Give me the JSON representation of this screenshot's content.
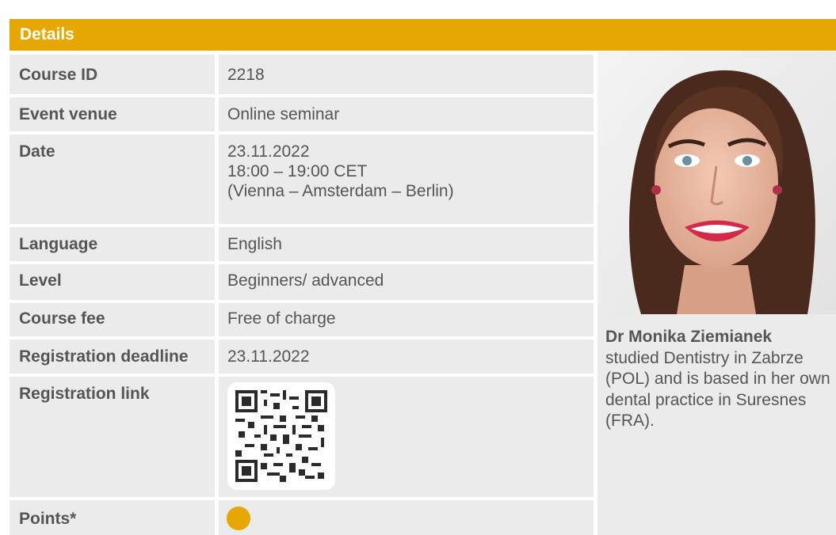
{
  "header": {
    "title": "Details"
  },
  "rows": [
    {
      "label": "Course ID",
      "value": "2218"
    },
    {
      "label": "Event venue",
      "value": "Online seminar"
    },
    {
      "label": "Date",
      "lines": [
        "23.11.2022",
        "18:00 – 19:00 CET",
        "(Vienna – Amsterdam – Berlin)"
      ]
    },
    {
      "label": "Language",
      "value": "English"
    },
    {
      "label": "Level",
      "value": "Beginners/ advanced"
    },
    {
      "label": "Course fee",
      "value": "Free of charge"
    },
    {
      "label": "Registration deadline",
      "value": "23.11.2022"
    },
    {
      "label": "Registration link",
      "value_icon": "qr-code-icon"
    },
    {
      "label": "Points*",
      "value_icon": "points-dot-icon"
    }
  ],
  "speaker": {
    "name": "Dr Monika Ziemianek",
    "bio": "studied Dentistry in Zabrze (POL) and is based in her own dental practice in Suresnes (FRA)."
  },
  "colors": {
    "accent": "#e6a800",
    "cell_bg": "#ebebeb",
    "text": "#555555"
  }
}
